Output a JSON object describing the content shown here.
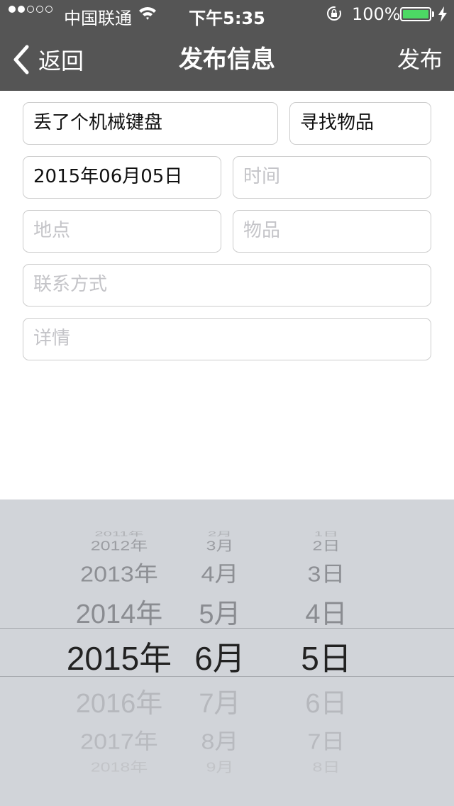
{
  "status_bar": {
    "carrier": "中国联通",
    "time": "下午5:35",
    "battery": "100%",
    "signal_dots_filled": 2,
    "signal_dots_total": 5,
    "battery_color": "#4cd964"
  },
  "nav": {
    "back_label": "返回",
    "title": "发布信息",
    "action_label": "发布",
    "bar_color": "#555555"
  },
  "form": {
    "title_value": "丢了个机械键盘",
    "category_value": "寻找物品",
    "date_value": "2015年06月05日",
    "time_placeholder": "时间",
    "location_placeholder": "地点",
    "item_placeholder": "物品",
    "contact_placeholder": "联系方式",
    "details_placeholder": "详情"
  },
  "picker": {
    "years": [
      "2011年",
      "2012年",
      "2013年",
      "2014年",
      "2015年",
      "2016年",
      "2017年",
      "2018年"
    ],
    "months": [
      "2月",
      "3月",
      "4月",
      "5月",
      "6月",
      "7月",
      "8月",
      "9月"
    ],
    "days": [
      "1日",
      "2日",
      "3日",
      "4日",
      "5日",
      "6日",
      "7日",
      "8日"
    ],
    "selected": {
      "year": "2015年",
      "month": "6月",
      "day": "5日"
    }
  }
}
